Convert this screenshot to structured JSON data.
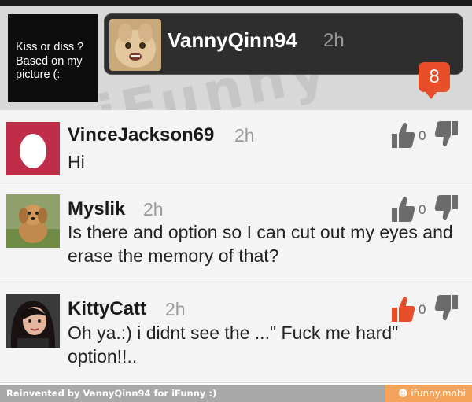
{
  "post": {
    "caption": "Kiss or diss ? Based on my picture (:",
    "author": "VannyQinn94",
    "time": "2h",
    "comment_count": "8"
  },
  "comments": [
    {
      "username": "VinceJackson69",
      "time": "2h",
      "text": "Hi",
      "votes": "0",
      "liked": false
    },
    {
      "username": "Myslik",
      "time": "2h",
      "text": "Is there and option so I can cut out my eyes and erase the memory of that?",
      "votes": "0",
      "liked": false
    },
    {
      "username": "KittyCatt",
      "time": "2h",
      "text": "Oh ya.:) i didnt see the ...\" Fuck me hard\" option!!..",
      "votes": "0",
      "liked": true
    }
  ],
  "footer": {
    "credit": "Reinvented by VannyQinn94 for iFunny :)",
    "site": "ifunny.mobi"
  },
  "colors": {
    "accent": "#e84e2a",
    "vote_inactive": "#6b6b6b",
    "vote_active": "#e84e2a"
  }
}
